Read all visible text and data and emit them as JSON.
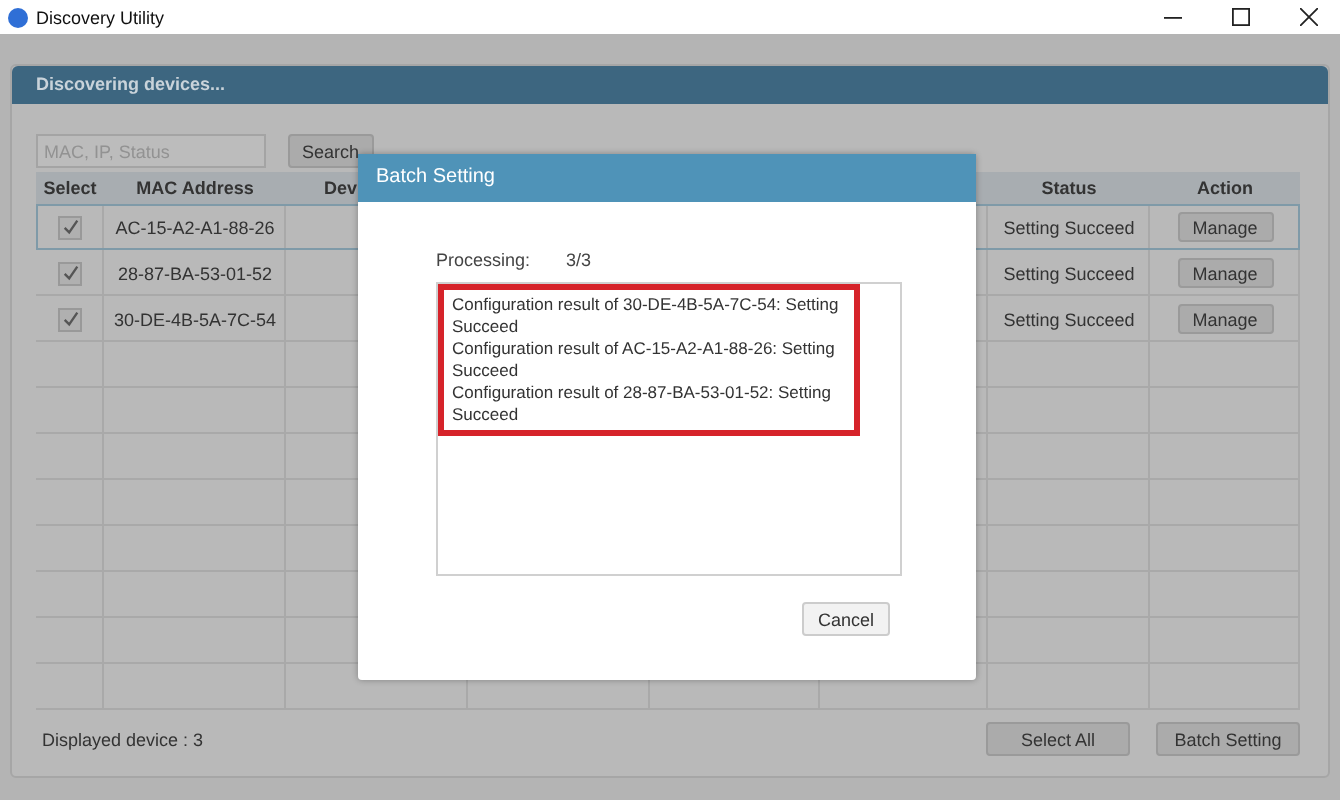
{
  "window": {
    "title": "Discovery Utility"
  },
  "panel": {
    "title": "Discovering devices..."
  },
  "search": {
    "placeholder": "MAC, IP, Status",
    "button": "Search"
  },
  "table": {
    "columns": [
      {
        "label": "Select"
      },
      {
        "label": "MAC Address"
      },
      {
        "label": "Dev"
      },
      {
        "label": "Status"
      },
      {
        "label": "Action"
      }
    ],
    "rows": [
      {
        "selected": true,
        "checked": true,
        "mac": "AC-15-A2-A1-88-26",
        "status": "Setting Succeed",
        "action": "Manage"
      },
      {
        "selected": false,
        "checked": true,
        "mac": "28-87-BA-53-01-52",
        "status": "Setting Succeed",
        "action": "Manage"
      },
      {
        "selected": false,
        "checked": true,
        "mac": "30-DE-4B-5A-7C-54",
        "status": "Setting Succeed",
        "action": "Manage"
      }
    ]
  },
  "footer": {
    "count": "Displayed device : 3",
    "buttons": [
      "Select All",
      "Batch Setting"
    ]
  },
  "dialog": {
    "title": "Batch Setting",
    "progress_label": "Processing:",
    "progress_value": "3/3",
    "log": [
      "Configuration result of 30-DE-4B-5A-7C-54: Setting Succeed",
      "Configuration result of AC-15-A2-A1-88-26: Setting Succeed",
      "Configuration result of 28-87-BA-53-01-52: Setting Succeed"
    ],
    "button": "Cancel"
  }
}
